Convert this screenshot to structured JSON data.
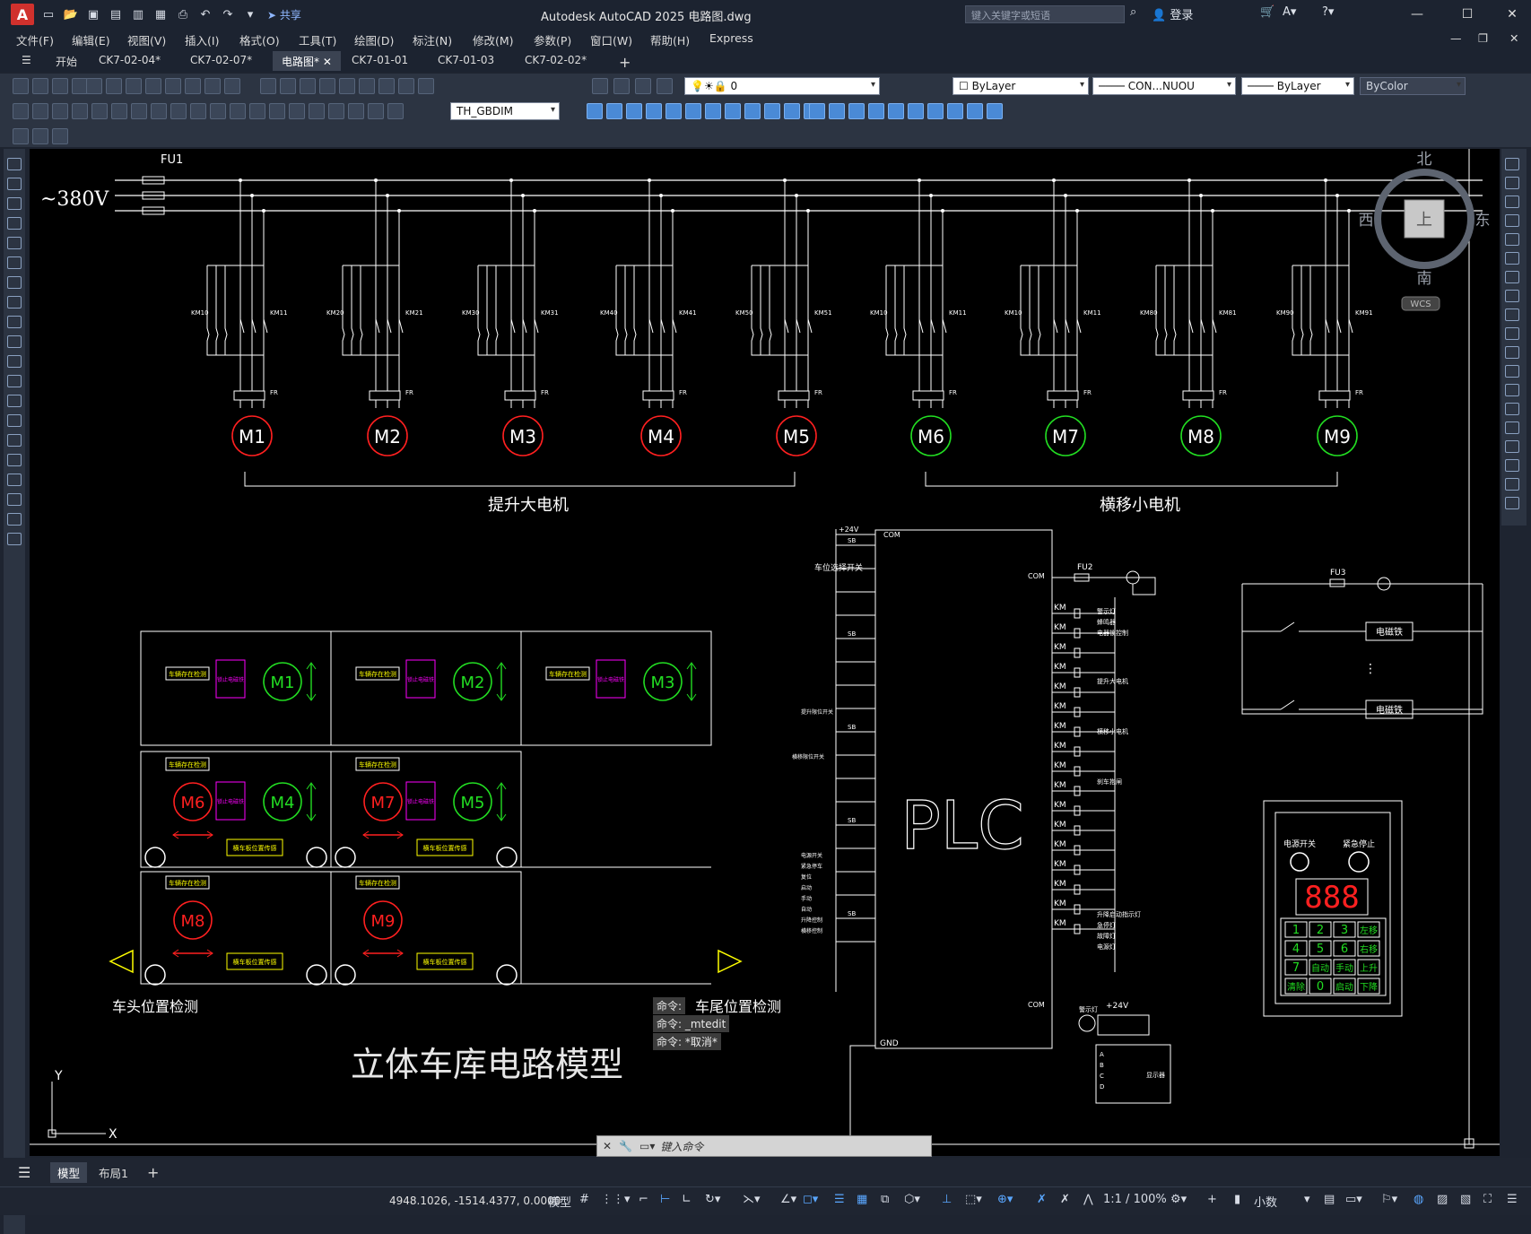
{
  "app": {
    "logo": "A",
    "title": "Autodesk AutoCAD 2025    电路图.dwg",
    "share_label": "共享",
    "search_placeholder": "键入关键字或短语",
    "login_label": "登录"
  },
  "menu": [
    "文件(F)",
    "编辑(E)",
    "视图(V)",
    "插入(I)",
    "格式(O)",
    "工具(T)",
    "绘图(D)",
    "标注(N)",
    "修改(M)",
    "参数(P)",
    "窗口(W)",
    "帮助(H)",
    "Express"
  ],
  "doc_tabs": [
    "开始",
    "CK7-02-04*",
    "CK7-02-07*",
    "电路图*",
    "CK7-01-01",
    "CK7-01-03",
    "CK7-02-02*"
  ],
  "active_doc_tab": "电路图*",
  "properties": {
    "layer": "0",
    "color": "ByLayer",
    "linetype": "CON...NUOU",
    "lineweight": "ByLayer",
    "plotstyle": "ByColor",
    "dimstyle": "TH_GBDIM"
  },
  "viewcube": {
    "north": "北",
    "south": "南",
    "east": "东",
    "west": "西",
    "face": "上",
    "wcs": "WCS"
  },
  "drawing": {
    "voltage": "~380V",
    "fuse_main": "FU1",
    "motors": [
      "M1",
      "M2",
      "M3",
      "M4",
      "M5",
      "M6",
      "M7",
      "M8",
      "M9"
    ],
    "km_labels": [
      "KM10",
      "KM11",
      "KM20",
      "KM21",
      "KM30",
      "KM31",
      "KM40",
      "KM41",
      "KM50",
      "KM51",
      "KM10",
      "KM11",
      "KM10",
      "KM11",
      "KM80",
      "KM81",
      "KM90",
      "KM91"
    ],
    "relay_label": "FR",
    "group_lift": "提升大电机",
    "group_traverse": "横移小电机",
    "plc_text": "PLC",
    "plc_com": "COM",
    "plc_gnd": "GND",
    "plc_24v": "+24V",
    "fu2": "FU2",
    "fu3": "FU3",
    "plc_outputs": [
      "警示灯",
      "蜂鸣器",
      "电器锁控制",
      "提升大电机",
      "横移小电机",
      "刹车抱闸",
      "升降启动指示灯",
      "急停灯",
      "故障灯",
      "电源灯"
    ],
    "plc_inputs_left": [
      "车位选择开关",
      "提升限位开关",
      "横移限位开关",
      "电源开关",
      "紧急停车",
      "复位",
      "启动",
      "手动",
      "自动",
      "升降控制",
      "横移控制"
    ],
    "magnet": "电磁铁",
    "garage_tag_a": "车辆存在检测",
    "garage_tag_b": "横车板位置传感",
    "garage_tag_lock": "锁止电磁铁",
    "garage_garage_motors": [
      "M1",
      "M2",
      "M3",
      "M6",
      "M4",
      "M7",
      "M5",
      "M8",
      "M9"
    ],
    "head_detect": "车头位置检测",
    "tail_detect": "车尾位置检测",
    "model_title": "立体车库电路模型",
    "panel_power": "电源开关",
    "panel_estop": "紧急停止",
    "panel_display": "888",
    "panel_warn": "警示灯",
    "panel_display_label": "显示器",
    "keypad": [
      "1",
      "2",
      "3",
      "左移",
      "4",
      "5",
      "6",
      "右移",
      "7",
      "自动",
      "手动",
      "上升",
      "清除",
      "0",
      "启动",
      "下降"
    ],
    "axis_x": "X",
    "axis_y": "Y"
  },
  "command": {
    "history": [
      "命令:",
      "命令: _mtedit",
      "命令: *取消*"
    ],
    "placeholder": "键入命令"
  },
  "layout_tabs": [
    "模型",
    "布局1"
  ],
  "status": {
    "coords": "4948.1026, -1514.4377, 0.0000",
    "model": "模型",
    "scale": "1:1 / 100%",
    "units": "小数"
  },
  "colors": {
    "motor_red": "#ff2020",
    "motor_green": "#22dd22",
    "tag_yellow": "#ffff00",
    "tag_magenta": "#ff00ff",
    "canvas_bg": "#000000"
  }
}
